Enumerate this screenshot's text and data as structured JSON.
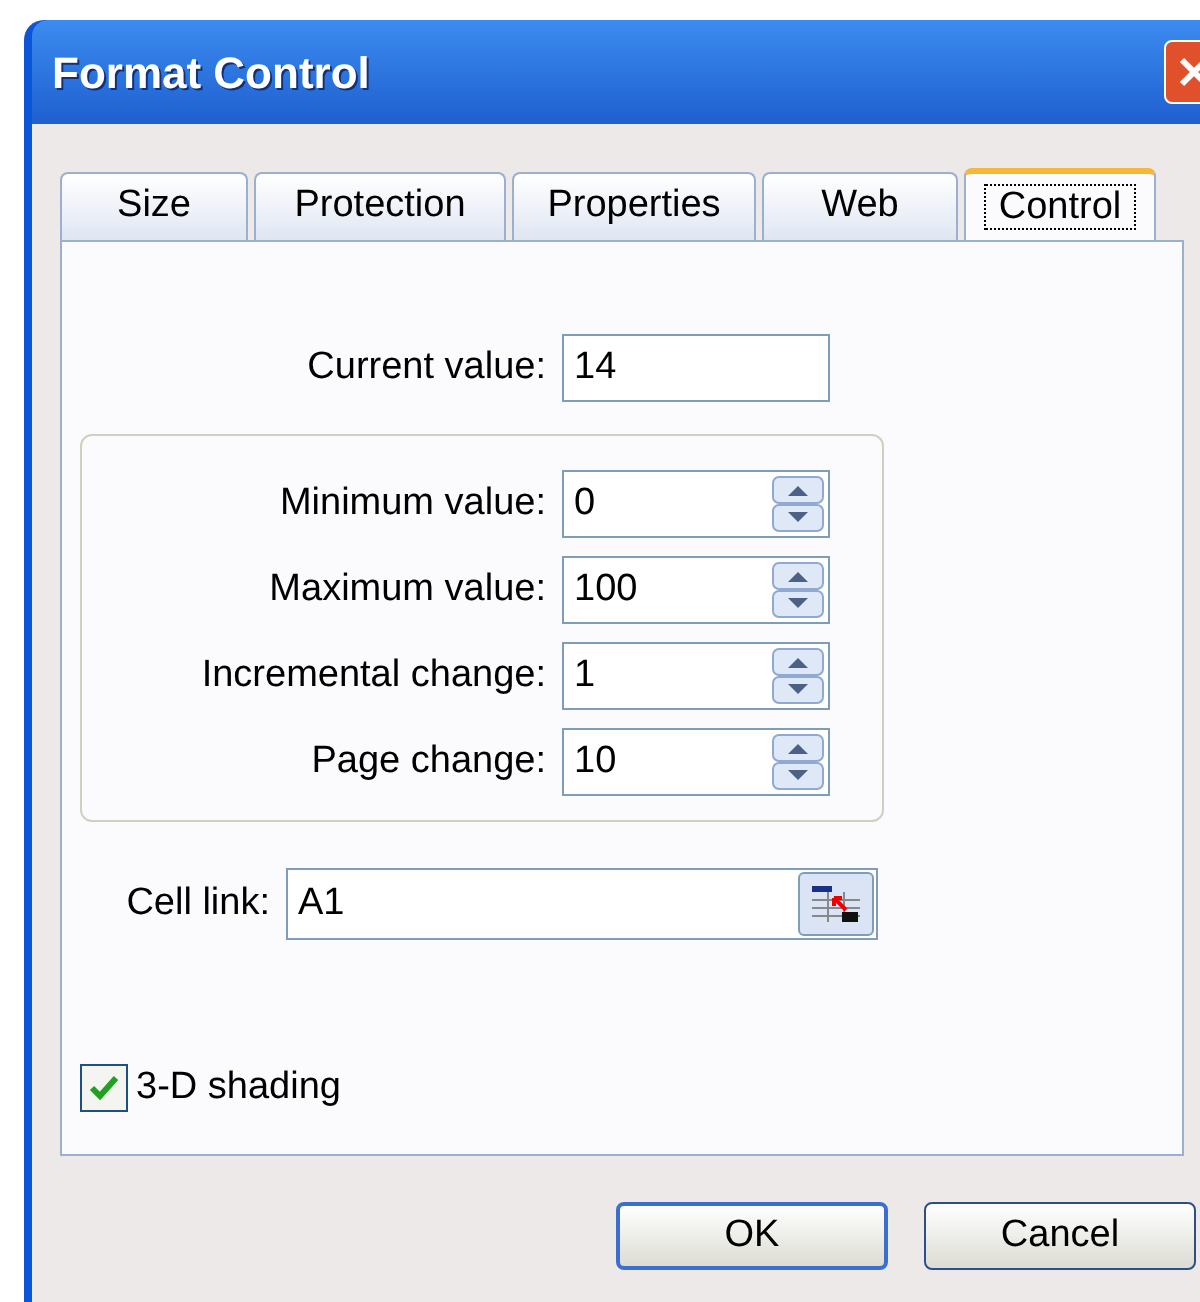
{
  "window": {
    "title": "Format Control"
  },
  "tabs": [
    {
      "label": "Size",
      "selected": false
    },
    {
      "label": "Protection",
      "selected": false
    },
    {
      "label": "Properties",
      "selected": false
    },
    {
      "label": "Web",
      "selected": false
    },
    {
      "label": "Control",
      "selected": true
    }
  ],
  "current_value": {
    "label": "Current value:",
    "value": "14"
  },
  "spin_fields": [
    {
      "label": "Minimum value:",
      "value": "0"
    },
    {
      "label": "Maximum value:",
      "value": "100"
    },
    {
      "label": "Incremental change:",
      "value": "1"
    },
    {
      "label": "Page change:",
      "value": "10"
    }
  ],
  "cell_link": {
    "label": "Cell link:",
    "value": "A1"
  },
  "shading": {
    "label": "3-D shading",
    "checked": true
  },
  "buttons": [
    {
      "label": "OK",
      "default": true
    },
    {
      "label": "Cancel",
      "default": false
    }
  ]
}
